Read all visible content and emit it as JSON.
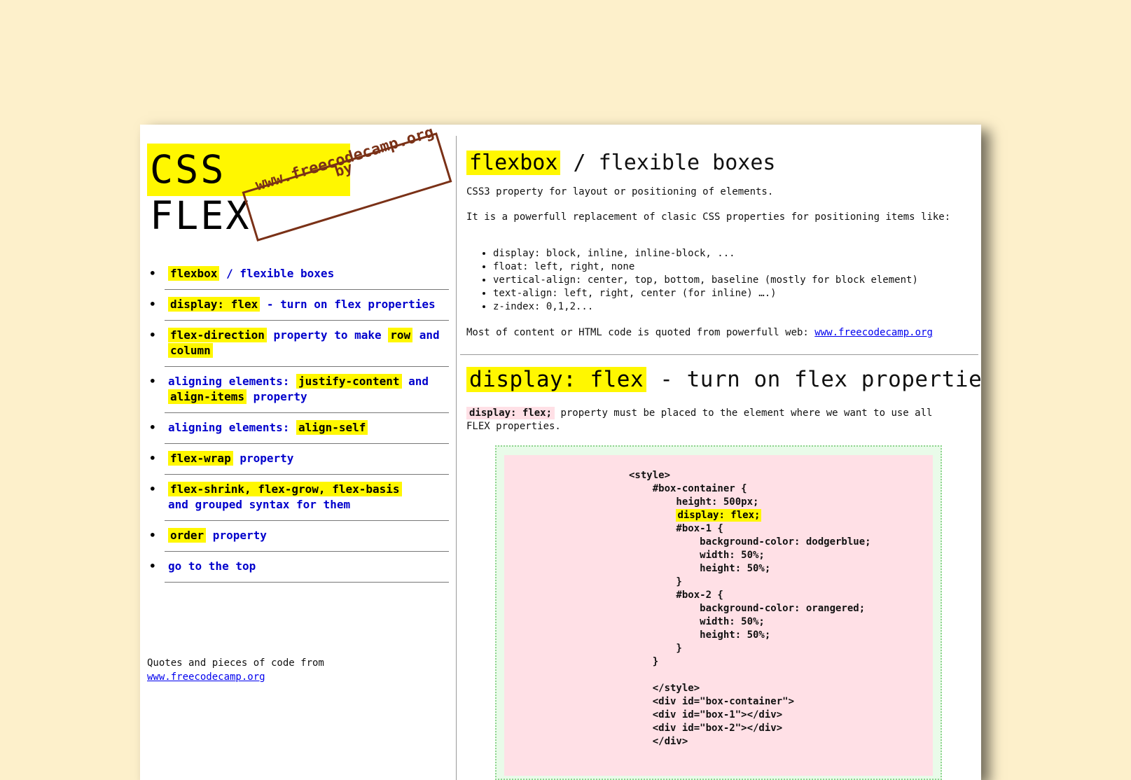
{
  "sidebar": {
    "logo_title": "CSS FLEX",
    "logo_by": "by",
    "logo_url": "www.freecodecamp.org",
    "nav": [
      {
        "hl": "flexbox",
        "text": " / flexible boxes"
      },
      {
        "hl": "display: flex",
        "text": " - turn on flex properties"
      },
      {
        "hl": "flex-direction",
        "text": " property to make ",
        "hl2": "row",
        "text2": " and ",
        "hl3": "column"
      },
      {
        "pre": "aligning elements: ",
        "hl": "justify-content",
        "text": " and ",
        "hl2": "align-items",
        "text2": " property"
      },
      {
        "pre": "aligning elements: ",
        "hl": "align-self"
      },
      {
        "hl": "flex-wrap",
        "text": " property"
      },
      {
        "hl": "flex-shrink, flex-grow, flex-basis",
        "text": " and grouped syntax for them"
      },
      {
        "hl": "order",
        "text": " property"
      },
      {
        "text": "go to the top"
      }
    ],
    "footer_text": "Quotes and pieces of code from",
    "footer_link": "www.freecodecamp.org"
  },
  "section1": {
    "title_hl": "flexbox",
    "title_rest": " / flexible boxes",
    "p1": "CSS3 property for layout or positioning of elements.",
    "p2": "It is a powerfull replacement of clasic CSS properties for positioning items like:",
    "list": [
      "display: block, inline, inline-block, ...",
      "float: left, right, none",
      "vertical-align: center, top, bottom, baseline (mostly for block element)",
      "text-align: left, right, center (for inline) ….)",
      "z-index: 0,1,2..."
    ],
    "p3_text": "Most of content or HTML code is quoted from powerfull web: ",
    "p3_link": "www.freecodecamp.org"
  },
  "section2": {
    "title_hl": "display: flex",
    "title_rest": " - turn on flex properties",
    "code_inline": "display: flex;",
    "p_rest": " property must be placed to the element where we want to use all FLEX properties.",
    "code_lines_before": "<style>\n    #box-container {\n        height: 500px;\n        ",
    "code_hl": "display: flex;",
    "code_lines_after": "\n        #box-1 {\n            background-color: dodgerblue;\n            width: 50%;\n            height: 50%;\n        }\n        #box-2 {\n            background-color: orangered;\n            width: 50%;\n            height: 50%;\n        }\n    }\n\n    </style>\n    <div id=\"box-container\">\n    <div id=\"box-1\"></div>\n    <div id=\"box-2\"></div>\n    </div>"
  }
}
